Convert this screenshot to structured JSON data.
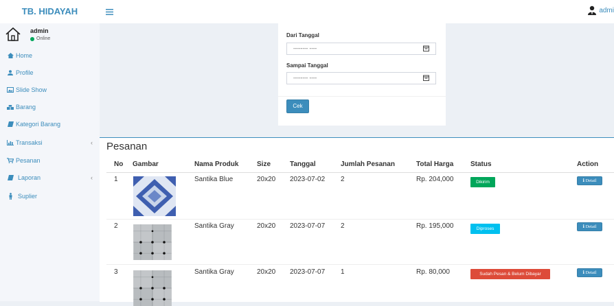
{
  "app": {
    "brand": "TB. HIDAYAH",
    "top_user": "admi"
  },
  "user_panel": {
    "name": "admin",
    "status": "Online",
    "status_color": "#00a65a"
  },
  "sidebar": {
    "items": [
      {
        "label": "Home",
        "icon": "home-icon"
      },
      {
        "label": "Profile",
        "icon": "user-icon"
      },
      {
        "label": "Slide Show",
        "icon": "image-icon"
      },
      {
        "label": "Barang",
        "icon": "cubes-icon"
      },
      {
        "label": "Kategori Barang",
        "icon": "book-icon"
      },
      {
        "label": "Transaksi",
        "icon": "bar-chart-icon",
        "chevron": "‹"
      },
      {
        "label": "Pesanan",
        "icon": "cart-icon"
      },
      {
        "label": "Laporan",
        "icon": "book-icon",
        "chevron": "‹"
      },
      {
        "label": "Suplier",
        "icon": "person-icon"
      }
    ]
  },
  "filter": {
    "from_label": "Dari Tanggal",
    "from_value": "-------- ----",
    "to_label": "Sampai Tanggal",
    "to_value": "-------- ----",
    "submit_label": "Cek"
  },
  "orders": {
    "title": "Pesanan",
    "columns": [
      "No",
      "Gambar",
      "Nama Produk",
      "Size",
      "Tanggal",
      "Jumlah Pesanan",
      "Total Harga",
      "Status",
      "Action"
    ],
    "rows": [
      {
        "no": "1",
        "image": "santika-blue-tile",
        "product": "Santika Blue",
        "size": "20x20",
        "date": "2023-07-02",
        "qty": "2",
        "total": "Rp. 204,000",
        "status": "Dikirim",
        "status_color": "#00a65a",
        "action": "ℹ Detail"
      },
      {
        "no": "2",
        "image": "santika-gray-tile",
        "product": "Santika Gray",
        "size": "20x20",
        "date": "2023-07-07",
        "qty": "2",
        "total": "Rp. 195,000",
        "status": "Diproses",
        "status_color": "#00c0ef",
        "action": "ℹ Detail"
      },
      {
        "no": "3",
        "image": "santika-gray-tile",
        "product": "Santika Gray",
        "size": "20x20",
        "date": "2023-07-07",
        "qty": "1",
        "total": "Rp. 80,000",
        "status": "Sudah Pesan & Belum Dibayar",
        "status_color": "#dd4b39",
        "action": "ℹ Detail"
      }
    ]
  },
  "colors": {
    "accent": "#3c8dbc",
    "background": "#ecf0f5",
    "sidebar": "#f4f6fa"
  }
}
